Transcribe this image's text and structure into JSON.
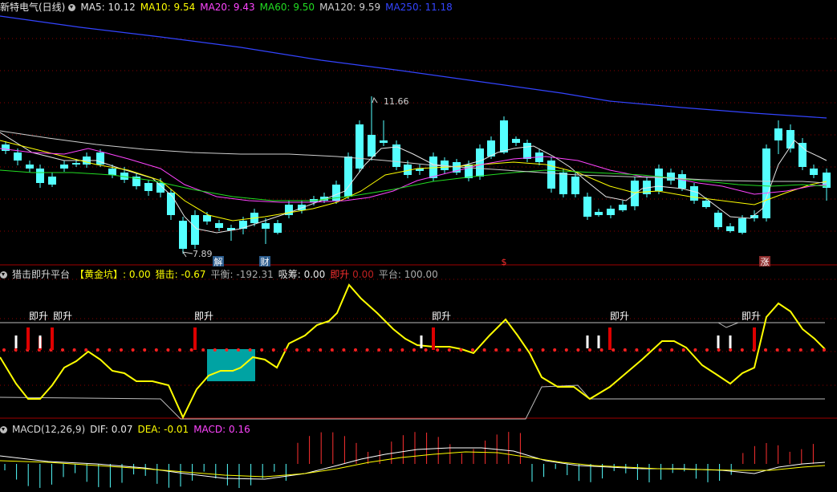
{
  "main": {
    "stock": "新特电气(日线)",
    "ma": [
      {
        "label": "MA5",
        "value": "10.12",
        "color": "#e6e6e6"
      },
      {
        "label": "MA10",
        "value": "9.54",
        "color": "#ffff00"
      },
      {
        "label": "MA20",
        "value": "9.43",
        "color": "#ff44ff"
      },
      {
        "label": "MA60",
        "value": "9.50",
        "color": "#22dd22"
      },
      {
        "label": "MA120",
        "value": "9.59",
        "color": "#cfcfcf"
      },
      {
        "label": "MA250",
        "value": "11.18",
        "color": "#3344ff"
      }
    ],
    "high_label": "11.66",
    "low_label": "7.89",
    "markers": [
      {
        "text": "解",
        "bg": "#2b5b8c"
      },
      {
        "text": "财",
        "bg": "#2b5b8c"
      },
      {
        "text": "$",
        "bg": "none"
      },
      {
        "text": "涨",
        "bg": "#8c2b2b"
      }
    ]
  },
  "ind": {
    "title": "猎击即升平台",
    "f1_label": "【黄金坑】",
    "f1_value": ": 0.00",
    "f2_label": "猎击:",
    "f2_value": "-0.67",
    "f3": "平衡: -192.31",
    "f4": "吸筹: 0.00",
    "f5_label": "即升",
    "f5_value": "0.00",
    "f6": "平台: 100.00",
    "signal_text": "即升"
  },
  "macd": {
    "title": "MACD(12,26,9)",
    "dif": "DIF: 0.07",
    "dea": "DEA: -0.01",
    "macd": "MACD: 0.16"
  },
  "colors": {
    "up": "#ff3030",
    "down": "#54ffff",
    "grid": "#8b0000",
    "yellow": "#ffff00"
  }
}
